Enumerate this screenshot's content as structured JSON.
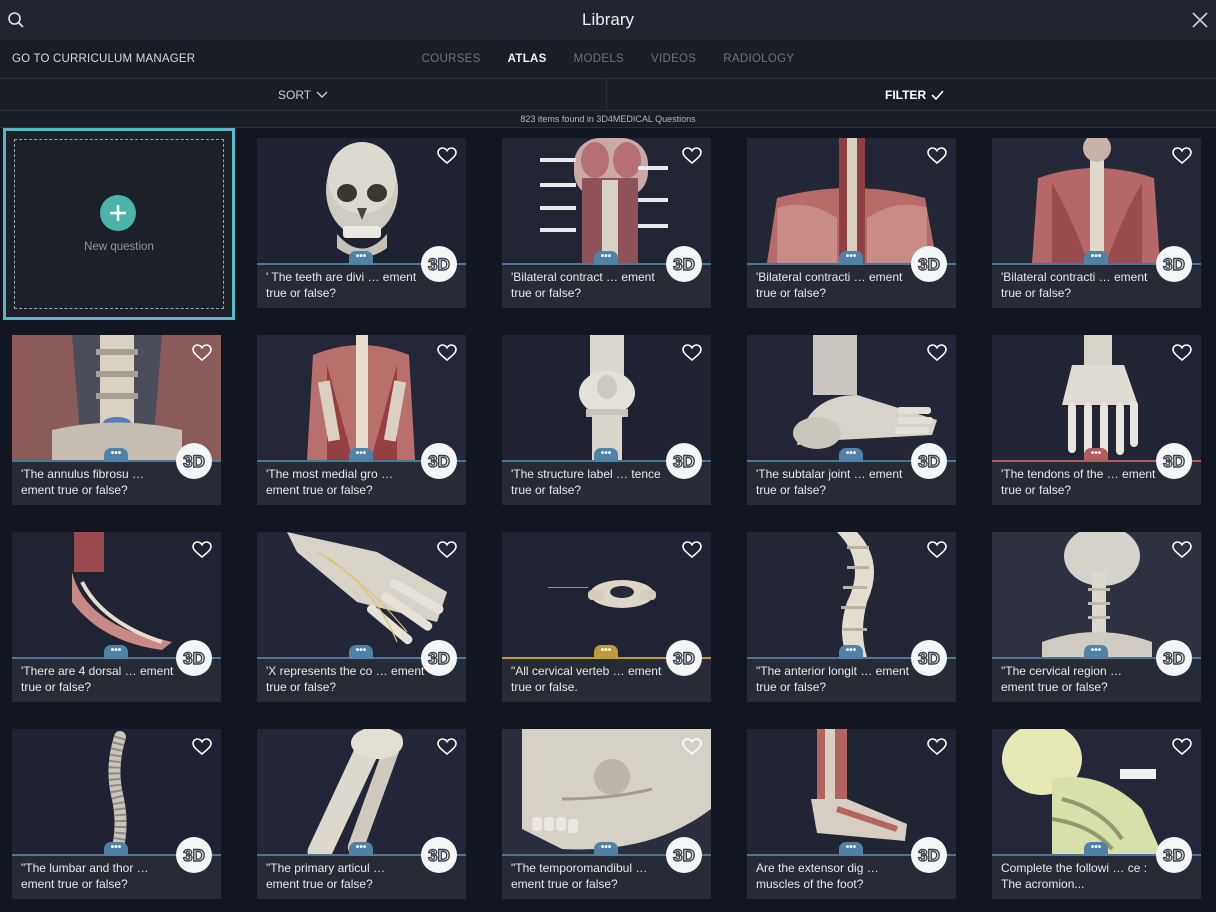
{
  "app": {
    "title": "Library",
    "curriculum_link": "GO TO CURRICULUM MANAGER",
    "tabs": [
      {
        "label": "COURSES",
        "active": false
      },
      {
        "label": "ATLAS",
        "active": true
      },
      {
        "label": "MODELS",
        "active": false
      },
      {
        "label": "VIDEOS",
        "active": false
      },
      {
        "label": "RADIOLOGY",
        "active": false
      }
    ],
    "sort_label": "SORT",
    "filter_label": "FILTER",
    "count_text": "823 items found in 3D4MEDICAL Questions",
    "accent_color": "#59b9c4"
  },
  "new_question": {
    "label": "New question"
  },
  "cards": [
    {
      "line1": "' The teeth are divi … ement",
      "line2": "true or false?",
      "thumb": "skull",
      "accent": "blue"
    },
    {
      "line1": "'Bilateral contract … ement",
      "line2": "true or false?",
      "thumb": "neck-back",
      "accent": "blue"
    },
    {
      "line1": "'Bilateral contracti … ement",
      "line2": "true or false?",
      "thumb": "upper-back",
      "accent": "blue"
    },
    {
      "line1": "'Bilateral contracti … ement",
      "line2": "true or false?",
      "thumb": "back-muscles",
      "accent": "blue"
    },
    {
      "line1": "'The annulus fibrosu …",
      "line2": "ement true or false?",
      "thumb": "lumbar",
      "accent": "blue"
    },
    {
      "line1": "'The most medial gro …",
      "line2": "ement true or false?",
      "thumb": "back-deep",
      "accent": "blue"
    },
    {
      "line1": "'The structure label … tence",
      "line2": "true or false?",
      "thumb": "knee",
      "accent": "blue"
    },
    {
      "line1": "'The subtalar joint … ement",
      "line2": "true or false?",
      "thumb": "ankle",
      "accent": "blue"
    },
    {
      "line1": "'The tendons of the … ement",
      "line2": "true or false?",
      "thumb": "foot-top",
      "accent": "red"
    },
    {
      "line1": "'There are 4 dorsal … ement",
      "line2": "true or false?",
      "thumb": "foot-muscle",
      "accent": "blue"
    },
    {
      "line1": "'X represents the co … ement",
      "line2": "true or false?",
      "thumb": "foot-nerves",
      "accent": "blue"
    },
    {
      "line1": "\"All cervical verteb … ement",
      "line2": "true or false.",
      "thumb": "vertebra",
      "accent": "gold"
    },
    {
      "line1": "\"The anterior longit … ement",
      "line2": "true or false?",
      "thumb": "spine-side",
      "accent": "blue"
    },
    {
      "line1": "\"The cervical region …",
      "line2": "ement true or false?",
      "thumb": "skull-spine",
      "accent": "blue"
    },
    {
      "line1": "\"The lumbar and thor …",
      "line2": "ement true or false?",
      "thumb": "spine-full",
      "accent": "blue"
    },
    {
      "line1": "\"The primary articul …",
      "line2": "ement true or false?",
      "thumb": "leg-bones",
      "accent": "blue"
    },
    {
      "line1": "\"The temporomandibul …",
      "line2": "ement true or false?",
      "thumb": "jaw",
      "accent": "blue"
    },
    {
      "line1": "Are the extensor dig …",
      "line2": "muscles of the foot?",
      "thumb": "leg-foot",
      "accent": "blue"
    },
    {
      "line1": "Complete the followi … ce :",
      "line2": "The acromion...",
      "thumb": "shoulder",
      "accent": "blue"
    }
  ],
  "badge_label": "3D",
  "more_label": "•••"
}
